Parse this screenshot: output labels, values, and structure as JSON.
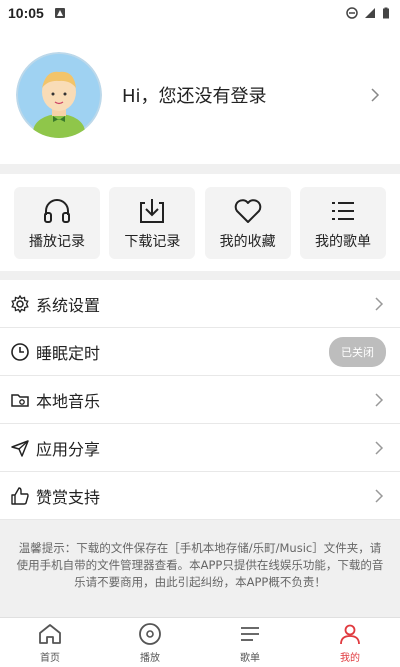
{
  "status": {
    "time": "10:05"
  },
  "profile": {
    "greeting": "Hi，您还没有登录"
  },
  "quick": [
    {
      "label": "播放记录",
      "icon": "headphones-icon"
    },
    {
      "label": "下载记录",
      "icon": "download-icon"
    },
    {
      "label": "我的收藏",
      "icon": "heart-icon"
    },
    {
      "label": "我的歌单",
      "icon": "list-icon"
    }
  ],
  "menu": [
    {
      "label": "系统设置",
      "icon": "gear-icon"
    },
    {
      "label": "睡眠定时",
      "icon": "clock-icon",
      "toggle": "已关闭"
    },
    {
      "label": "本地音乐",
      "icon": "folder-music-icon"
    },
    {
      "label": "应用分享",
      "icon": "share-icon"
    },
    {
      "label": "赞赏支持",
      "icon": "thumbs-up-icon"
    }
  ],
  "tips": "温馨提示：下载的文件保存在［手机本地存储/乐町/Music］文件夹，请使用手机自带的文件管理器查看。本APP只提供在线娱乐功能，下载的音乐请不要商用，由此引起纠纷，本APP概不负责！",
  "tabs": [
    {
      "label": "首页",
      "icon": "home-icon"
    },
    {
      "label": "播放",
      "icon": "play-disc-icon"
    },
    {
      "label": "歌单",
      "icon": "playlist-icon"
    },
    {
      "label": "我的",
      "icon": "user-icon",
      "active": true
    }
  ],
  "colors": {
    "accent": "#e0393e",
    "card_bg": "#f3f3f3",
    "divider": "#f0f0f0"
  }
}
